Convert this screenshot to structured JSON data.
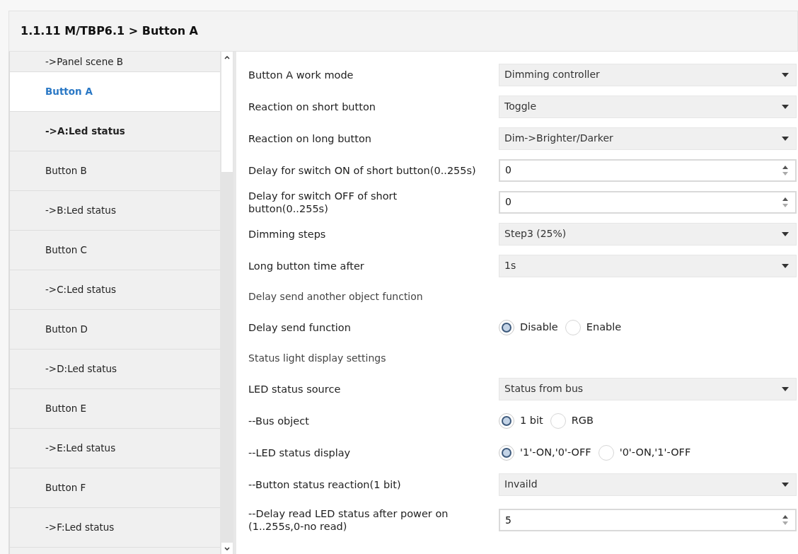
{
  "header": {
    "title": "1.1.11 M/TBP6.1 > Button A"
  },
  "sidebar": {
    "items": [
      {
        "label": "->Panel scene B",
        "selected": false,
        "bold": false
      },
      {
        "label": "Button A",
        "selected": true,
        "bold": false
      },
      {
        "label": "->A:Led status",
        "selected": false,
        "bold": true
      },
      {
        "label": "Button B",
        "selected": false,
        "bold": false
      },
      {
        "label": "->B:Led status",
        "selected": false,
        "bold": false
      },
      {
        "label": "Button C",
        "selected": false,
        "bold": false
      },
      {
        "label": "->C:Led status",
        "selected": false,
        "bold": false
      },
      {
        "label": "Button D",
        "selected": false,
        "bold": false
      },
      {
        "label": "->D:Led status",
        "selected": false,
        "bold": false
      },
      {
        "label": "Button E",
        "selected": false,
        "bold": false
      },
      {
        "label": "->E:Led status",
        "selected": false,
        "bold": false
      },
      {
        "label": "Button F",
        "selected": false,
        "bold": false
      },
      {
        "label": "->F:Led status",
        "selected": false,
        "bold": false
      }
    ]
  },
  "parameters": [
    {
      "kind": "select",
      "label": "Button A work mode",
      "value": "Dimming controller"
    },
    {
      "kind": "select",
      "label": "Reaction on short button",
      "value": "Toggle"
    },
    {
      "kind": "select",
      "label": "Reaction on long button",
      "value": "Dim->Brighter/Darker"
    },
    {
      "kind": "number",
      "label": "Delay for switch ON of short button(0..255s)",
      "value": "0"
    },
    {
      "kind": "number",
      "label": "Delay for switch OFF of short button(0..255s)",
      "value": "0"
    },
    {
      "kind": "select",
      "label": "Dimming steps",
      "value": "Step3 (25%)"
    },
    {
      "kind": "select",
      "label": "Long button time after",
      "value": "1s"
    },
    {
      "kind": "heading",
      "label": "Delay send another object function"
    },
    {
      "kind": "radio",
      "label": "Delay send function",
      "options": [
        {
          "label": "Disable",
          "selected": true
        },
        {
          "label": "Enable",
          "selected": false
        }
      ]
    },
    {
      "kind": "heading",
      "label": "Status light display settings"
    },
    {
      "kind": "select",
      "label": "LED status source",
      "value": "Status from bus"
    },
    {
      "kind": "radio",
      "label": "--Bus object",
      "options": [
        {
          "label": "1 bit",
          "selected": true
        },
        {
          "label": "RGB",
          "selected": false
        }
      ]
    },
    {
      "kind": "radio",
      "label": "--LED status display",
      "options": [
        {
          "label": "'1'-ON,'0'-OFF",
          "selected": true
        },
        {
          "label": "'0'-ON,'1'-OFF",
          "selected": false
        }
      ]
    },
    {
      "kind": "select",
      "label": "--Button status reaction(1 bit)",
      "value": "Invaild"
    },
    {
      "kind": "number",
      "label": "--Delay read LED status after power on (1..255s,0-no read)",
      "value": "5"
    }
  ]
}
